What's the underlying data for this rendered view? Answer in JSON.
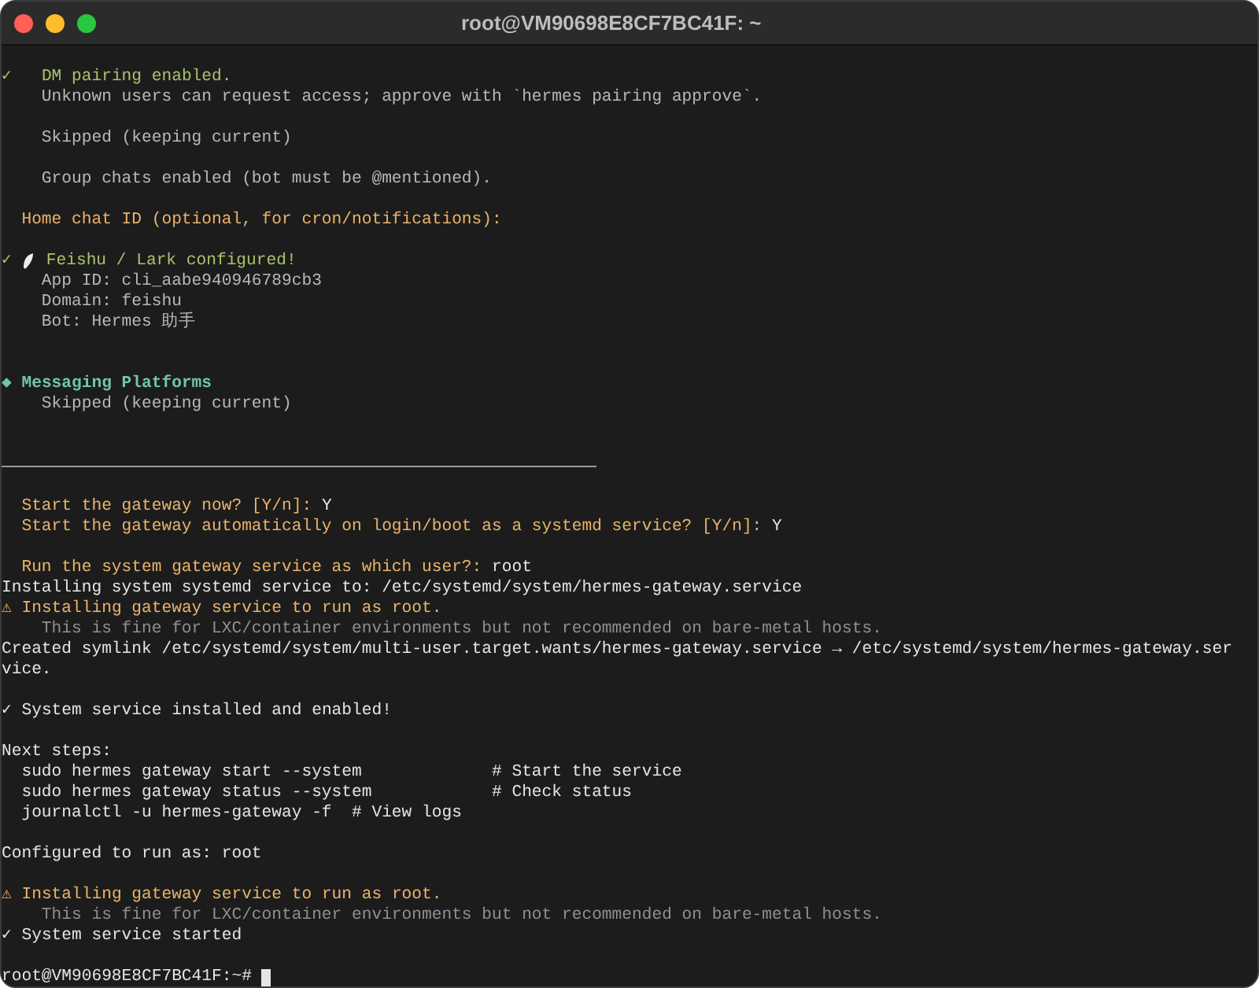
{
  "window": {
    "title": "root@VM90698E8CF7BC41F: ~"
  },
  "lines": [
    {
      "kind": "success",
      "text": "✓   DM pairing enabled."
    },
    {
      "kind": "info",
      "text": "    Unknown users can request access; approve with `hermes pairing approve`."
    },
    {
      "kind": "blank"
    },
    {
      "kind": "info",
      "text": "    Skipped (keeping current)"
    },
    {
      "kind": "blank"
    },
    {
      "kind": "info",
      "text": "    Group chats enabled (bot must be @mentioned)."
    },
    {
      "kind": "blank"
    },
    {
      "kind": "prompt",
      "text": "  Home chat ID (optional, for cron/notifications):"
    },
    {
      "kind": "blank"
    },
    {
      "kind": "success_icon",
      "mark": "✓",
      "text": "Feishu / Lark configured!"
    },
    {
      "kind": "info",
      "text": "    App ID: cli_aabe940946789cb3"
    },
    {
      "kind": "info",
      "text": "    Domain: feishu"
    },
    {
      "kind": "info",
      "text": "    Bot: Hermes 助手"
    },
    {
      "kind": "blank"
    },
    {
      "kind": "blank"
    },
    {
      "kind": "section",
      "text": "◆ Messaging Platforms"
    },
    {
      "kind": "info",
      "text": "    Skipped (keeping current)"
    },
    {
      "kind": "blank"
    },
    {
      "kind": "blank"
    },
    {
      "kind": "rule"
    },
    {
      "kind": "blank"
    },
    {
      "kind": "prompt",
      "text": "  Start the gateway now? [Y/n]: ",
      "answer": "Y"
    },
    {
      "kind": "prompt",
      "text": "  Start the gateway automatically on login/boot as a systemd service? [Y/n]: ",
      "answer": "Y"
    },
    {
      "kind": "blank"
    },
    {
      "kind": "prompt",
      "text": "  Run the system gateway service as which user?: ",
      "answer": "root"
    },
    {
      "kind": "plain",
      "text": "Installing system systemd service to: /etc/systemd/system/hermes-gateway.service"
    },
    {
      "kind": "warning",
      "text": "⚠ Installing gateway service to run as root."
    },
    {
      "kind": "note",
      "text": "    This is fine for LXC/container environments but not recommended on bare-metal hosts."
    },
    {
      "kind": "plain",
      "text": "Created symlink /etc/systemd/system/multi-user.target.wants/hermes-gateway.service → /etc/systemd/system/hermes-gateway.ser"
    },
    {
      "kind": "plain",
      "text": "vice."
    },
    {
      "kind": "blank"
    },
    {
      "kind": "plain",
      "text": "✓ System service installed and enabled!"
    },
    {
      "kind": "blank"
    },
    {
      "kind": "plain",
      "text": "Next steps:"
    },
    {
      "kind": "plain",
      "text": "  sudo hermes gateway start --system             # Start the service"
    },
    {
      "kind": "plain",
      "text": "  sudo hermes gateway status --system            # Check status"
    },
    {
      "kind": "plain",
      "text": "  journalctl -u hermes-gateway -f  # View logs"
    },
    {
      "kind": "blank"
    },
    {
      "kind": "plain",
      "text": "Configured to run as: root"
    },
    {
      "kind": "blank"
    },
    {
      "kind": "warning",
      "text": "⚠ Installing gateway service to run as root."
    },
    {
      "kind": "note",
      "text": "    This is fine for LXC/container environments but not recommended on bare-metal hosts."
    },
    {
      "kind": "plain",
      "text": "✓ System service started"
    },
    {
      "kind": "blank"
    },
    {
      "kind": "shell",
      "text": "root@VM90698E8CF7BC41F:~# "
    }
  ]
}
